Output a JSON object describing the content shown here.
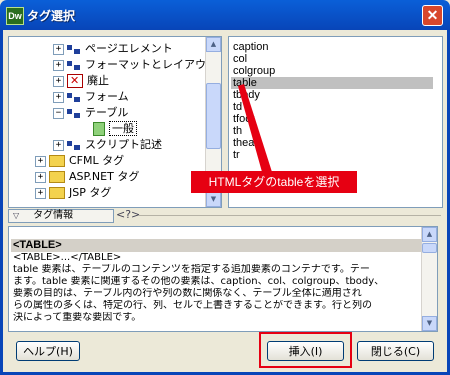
{
  "window": {
    "app_icon_text": "Dw",
    "title": "タグ選択"
  },
  "tree": {
    "items": [
      {
        "label": "ページエレメント",
        "expander": "+",
        "icon": "library-icon"
      },
      {
        "label": "フォーマットとレイアウト",
        "expander": "+",
        "icon": "library-icon"
      },
      {
        "label": "廃止",
        "expander": "+",
        "icon": "deprecated-icon"
      },
      {
        "label": "フォーム",
        "expander": "+",
        "icon": "library-icon"
      },
      {
        "label": "テーブル",
        "expander": "−",
        "icon": "library-icon"
      },
      {
        "label": "一般",
        "expander": "",
        "icon": "page-icon"
      },
      {
        "label": "スクリプト記述",
        "expander": "+",
        "icon": "library-icon"
      },
      {
        "label": "CFML タグ",
        "expander": "+",
        "icon": "folder-icon"
      },
      {
        "label": "ASP.NET タグ",
        "expander": "+",
        "icon": "folder-icon"
      },
      {
        "label": "JSP タグ",
        "expander": "+",
        "icon": "folder-icon"
      }
    ]
  },
  "tags": {
    "items": [
      "caption",
      "col",
      "colgroup",
      "table",
      "tbody",
      "td",
      "tfoot",
      "th",
      "thead",
      "tr"
    ],
    "selected": "table"
  },
  "annotation": {
    "text": "HTMLタグのtableを選択"
  },
  "info": {
    "tab_label": "タグ情報",
    "code_icon": "<?>"
  },
  "description": {
    "heading": "<TABLE>",
    "lines": [
      "<TABLE>...</TABLE>",
      "table 要素は、テーブルのコンテンツを指定する追加要素のコンテナです。テー",
      "ます。table 要素に関連するその他の要素は、caption、col、colgroup、tbody、",
      "要素の目的は、テーブル内の行や列の数に関係なく、テーブル全体に適用され",
      "らの属性の多くは、特定の行、列、セルで上書きすることができます。行と列の",
      "決によって重要な要因です。"
    ]
  },
  "buttons": {
    "help": "ヘルプ(H)",
    "insert": "挿入(I)",
    "close": "閉じる(C)"
  }
}
